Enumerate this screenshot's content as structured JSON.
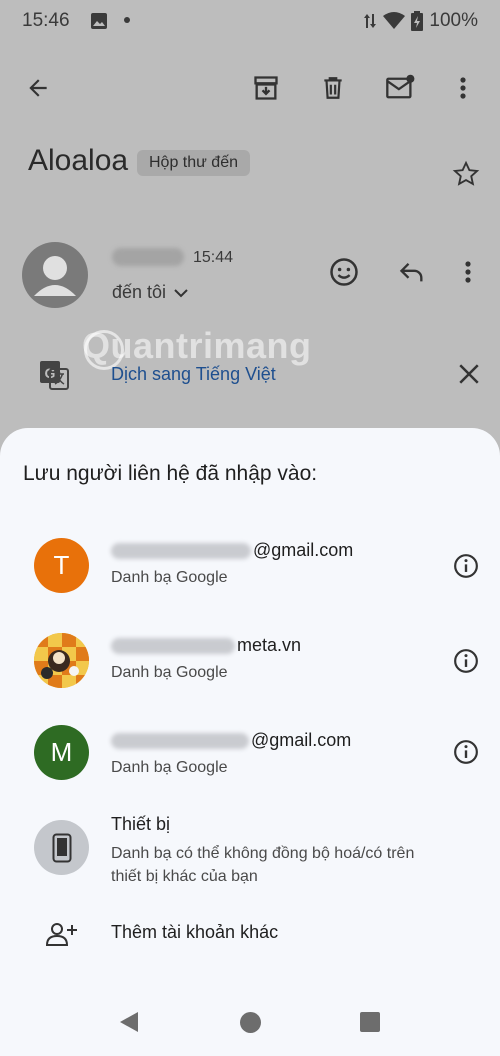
{
  "status": {
    "time": "15:46",
    "battery": "100%"
  },
  "email": {
    "subject": "Aloaloa",
    "label": "Hộp thư đến",
    "time": "15:44",
    "to": "đến tôi",
    "translate": "Dịch sang Tiếng Việt"
  },
  "watermark": "Quantrimang",
  "sheet": {
    "title": "Lưu người liên hệ đã nhập vào:",
    "accounts": [
      {
        "initial": "T",
        "email_suffix": "@gmail.com",
        "source": "Danh bạ Google",
        "color": "#e8710a"
      },
      {
        "initial": "",
        "email_suffix": "meta.vn",
        "source": "Danh bạ Google",
        "color": "#e8a33a"
      },
      {
        "initial": "M",
        "email_suffix": "@gmail.com",
        "source": "Danh bạ Google",
        "color": "#2e6b23"
      }
    ],
    "device": {
      "title": "Thiết bị",
      "description": "Danh bạ có thể không đồng bộ hoá/có trên thiết bị khác của bạn"
    },
    "add_account": "Thêm tài khoản khác"
  },
  "icons": {
    "back": "arrow-left-icon",
    "archive": "archive-icon",
    "delete": "trash-icon",
    "mark_unread": "mail-unread-icon",
    "more": "more-vert-icon",
    "star": "star-icon",
    "emoji": "emoji-icon",
    "reply": "reply-icon",
    "translate": "translate-icon",
    "close": "close-icon",
    "info": "info-icon",
    "phone": "phone-icon",
    "add_person": "person-add-icon"
  }
}
